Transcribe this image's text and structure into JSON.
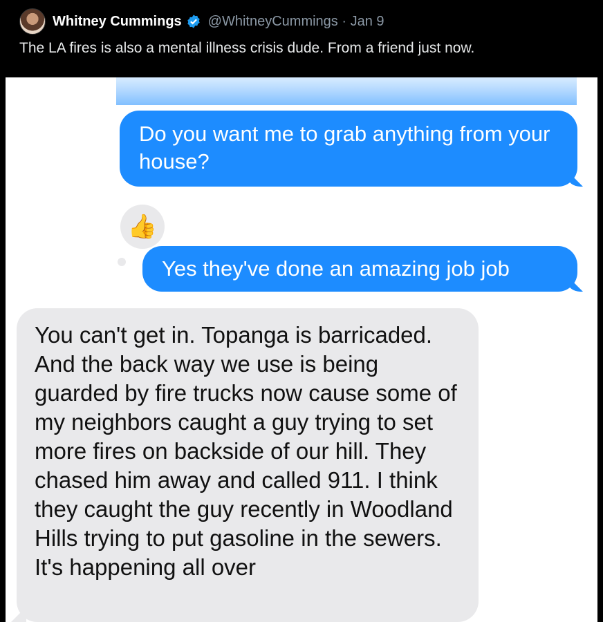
{
  "tweet": {
    "display_name": "Whitney Cummings",
    "handle_date": "@WhitneyCummings · Jan 9",
    "text": "The LA fires is also a mental illness crisis dude. From a friend just now.",
    "accent_verified": "#1d9bf0"
  },
  "conversation": {
    "messages": [
      {
        "sender": "me",
        "text": "Do you want me to grab anything from your house?"
      },
      {
        "sender": "me",
        "text": "Yes they've done an amazing job job"
      },
      {
        "sender": "friend",
        "text": "You can't get in. Topanga is barricaded. And the back way we use is being guarded by fire trucks now cause some of my neighbors caught a guy trying to set more fires on backside of our hill. They chased him away and called 911. I think they caught the guy recently in Woodland Hills trying to put gasoline in the sewers. It's happening all over"
      }
    ],
    "tapback": "👍",
    "colors": {
      "outgoing": "#1d8cff",
      "incoming": "#e9e9eb"
    }
  }
}
